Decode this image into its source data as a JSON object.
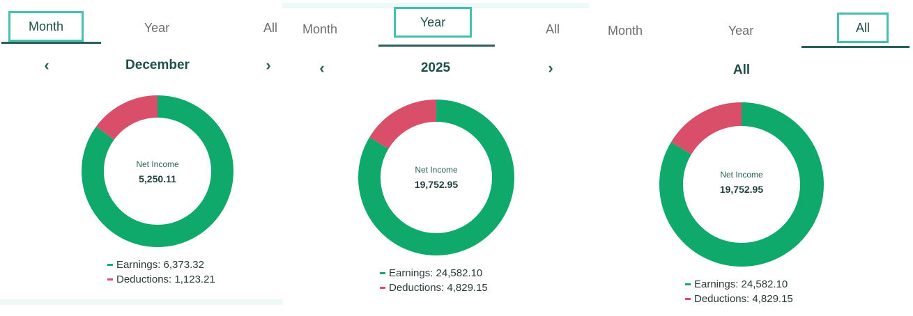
{
  "colors": {
    "earnings": "#0fa96b",
    "deductions": "#d94f6a",
    "accent": "#45bfae",
    "text": "#1f4f4a"
  },
  "panels": [
    {
      "tabs": [
        "Month",
        "Year",
        "All"
      ],
      "active_tab": "Month",
      "period": "December",
      "has_arrows": true,
      "net_income_label": "Net Income",
      "net_income_value": "5,250.11",
      "earnings_text": "Earnings: 6,373.32",
      "deductions_text": "Deductions: 1,123.21",
      "earnings_share": 0.85
    },
    {
      "tabs": [
        "Month",
        "Year",
        "All"
      ],
      "active_tab": "Year",
      "period": "2025",
      "has_arrows": true,
      "net_income_label": "Net Income",
      "net_income_value": "19,752.95",
      "earnings_text": "Earnings: 24,582.10",
      "deductions_text": "Deductions: 4,829.15",
      "earnings_share": 0.836
    },
    {
      "tabs": [
        "Month",
        "Year",
        "All"
      ],
      "active_tab": "All",
      "period": "All",
      "has_arrows": false,
      "net_income_label": "Net Income",
      "net_income_value": "19,752.95",
      "earnings_text": "Earnings: 24,582.10",
      "deductions_text": "Deductions: 4,829.15",
      "earnings_share": 0.836
    }
  ]
}
